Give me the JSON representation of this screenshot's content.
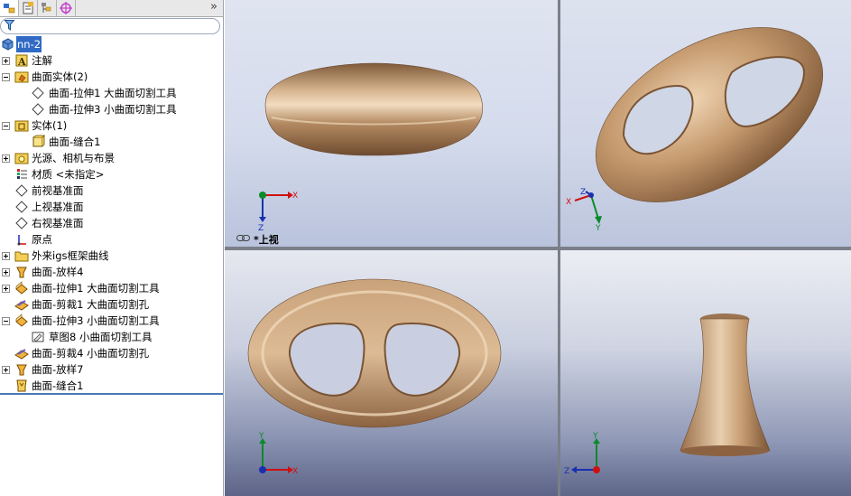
{
  "tabs": [
    {
      "name": "feature-manager-tab"
    },
    {
      "name": "property-manager-tab"
    },
    {
      "name": "configuration-manager-tab"
    },
    {
      "name": "display-manager-tab"
    }
  ],
  "tabs_more": "»",
  "tree": {
    "root": "nn-2",
    "items": [
      {
        "label": "注解",
        "expander": "plus",
        "icon": "annotation-icon"
      },
      {
        "label": "曲面实体(2)",
        "expander": "minus",
        "icon": "surface-bodies-folder-icon"
      },
      {
        "label": "曲面-拉伸1 大曲面切割工具",
        "expander": "",
        "icon": "surface-body-icon"
      },
      {
        "label": "曲面-拉伸3 小曲面切割工具",
        "expander": "",
        "icon": "surface-body-icon"
      },
      {
        "label": "实体(1)",
        "expander": "minus",
        "icon": "solid-bodies-folder-icon"
      },
      {
        "label": "曲面-缝合1",
        "expander": "",
        "icon": "solid-body-icon"
      },
      {
        "label": "光源、相机与布景",
        "expander": "plus",
        "icon": "lights-folder-icon"
      },
      {
        "label": "材质 <未指定>",
        "expander": "",
        "icon": "material-icon"
      },
      {
        "label": "前视基准面",
        "expander": "",
        "icon": "plane-icon"
      },
      {
        "label": "上视基准面",
        "expander": "",
        "icon": "plane-icon"
      },
      {
        "label": "右视基准面",
        "expander": "",
        "icon": "plane-icon"
      },
      {
        "label": "原点",
        "expander": "",
        "icon": "origin-icon"
      },
      {
        "label": "外来igs框架曲线",
        "expander": "plus",
        "icon": "folder-icon"
      },
      {
        "label": "曲面-放样4",
        "expander": "plus",
        "icon": "surface-loft-icon"
      },
      {
        "label": "曲面-拉伸1 大曲面切割工具",
        "expander": "plus",
        "icon": "surface-extrude-icon"
      },
      {
        "label": "曲面-剪裁1 大曲面切割孔",
        "expander": "",
        "icon": "surface-trim-icon"
      },
      {
        "label": "曲面-拉伸3 小曲面切割工具",
        "expander": "minus",
        "icon": "surface-extrude-icon"
      },
      {
        "label": "草图8 小曲面切割工具",
        "expander": "",
        "icon": "sketch-icon"
      },
      {
        "label": "曲面-剪裁4 小曲面切割孔",
        "expander": "",
        "icon": "surface-trim-icon"
      },
      {
        "label": "曲面-放样7",
        "expander": "plus",
        "icon": "surface-loft-icon"
      },
      {
        "label": "曲面-缝合1",
        "expander": "",
        "icon": "surface-knit-icon"
      }
    ]
  },
  "viewports": {
    "top_view_label": "*上视",
    "axis": {
      "x": "X",
      "y": "Y",
      "z": "Z"
    }
  },
  "colors": {
    "model_bronze": "#b08560",
    "axis_x": "#d01010",
    "axis_y": "#0a8a2a",
    "axis_z": "#1a2fb0",
    "selection": "#316ac5"
  }
}
